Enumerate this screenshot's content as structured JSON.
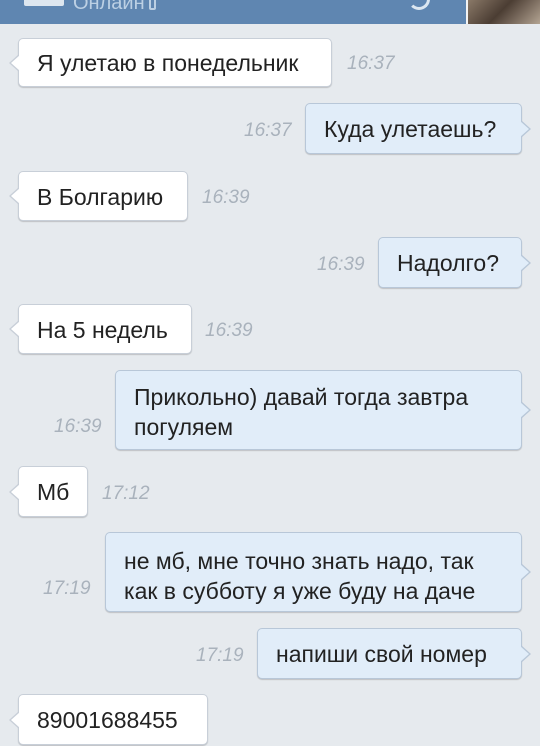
{
  "header": {
    "status": "Онлайн",
    "status_icon": "phone-icon",
    "accent": "#5f86b1"
  },
  "messages": [
    {
      "dir": "in",
      "text": "Я улетаю в понедельник",
      "time": "16:37"
    },
    {
      "dir": "out",
      "text": "Куда улетаешь?",
      "time": "16:37"
    },
    {
      "dir": "in",
      "text": "В Болгарию",
      "time": "16:39"
    },
    {
      "dir": "out",
      "text": "Надолго?",
      "time": "16:39"
    },
    {
      "dir": "in",
      "text": "На 5 недель",
      "time": "16:39"
    },
    {
      "dir": "out",
      "text": "Прикольно) давай тогда завтра погуляем",
      "time": "16:39"
    },
    {
      "dir": "in",
      "text": "Мб",
      "time": "17:12"
    },
    {
      "dir": "out",
      "text": "не мб, мне точно знать надо, так как в субботу я уже буду на даче",
      "time": "17:19"
    },
    {
      "dir": "out",
      "text": "напиши свой номер",
      "time": "17:19"
    },
    {
      "dir": "in",
      "text": "89001688455",
      "time": ""
    }
  ]
}
